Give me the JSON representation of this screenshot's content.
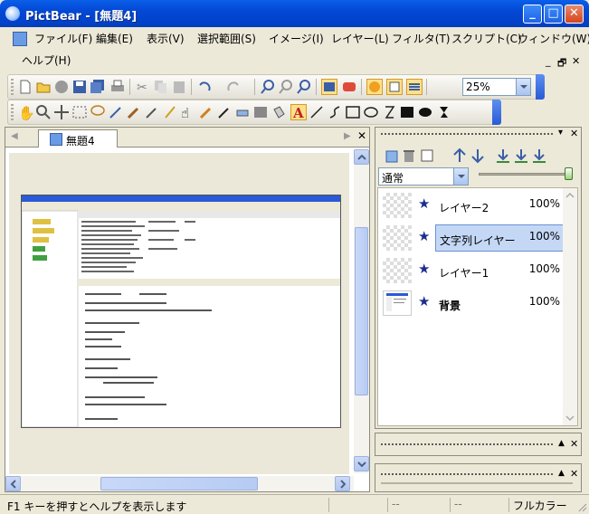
{
  "window": {
    "title": "PictBear - [無題4]"
  },
  "menu": [
    "ファイル(F)",
    "編集(E)",
    "表示(V)",
    "選択範囲(S)",
    "イメージ(I)",
    "レイヤー(L)",
    "フィルタ(T)",
    "スクリプト(C)",
    "ウィンドウ(W)",
    "ヘルプ(H)"
  ],
  "zoom": {
    "value": "25%"
  },
  "document": {
    "tab_title": "無題4"
  },
  "layers_panel": {
    "blend_mode": "通常",
    "opacity_slider": 100,
    "layers": [
      {
        "name": "レイヤー2",
        "opacity": "100%",
        "selected": false,
        "bold": false
      },
      {
        "name": "文字列レイヤー",
        "opacity": "100%",
        "selected": true,
        "bold": false
      },
      {
        "name": "レイヤー1",
        "opacity": "100%",
        "selected": false,
        "bold": false
      },
      {
        "name": "背景",
        "opacity": "100%",
        "selected": false,
        "bold": true
      }
    ]
  },
  "status": {
    "help_text": "F1 キーを押すとヘルプを表示します",
    "cell1": "--",
    "cell2": "--",
    "color_mode": "フルカラー"
  },
  "colors": {
    "title_bar": "#0348d6",
    "selection": "#c4d8f6",
    "face": "#ece9d8"
  }
}
